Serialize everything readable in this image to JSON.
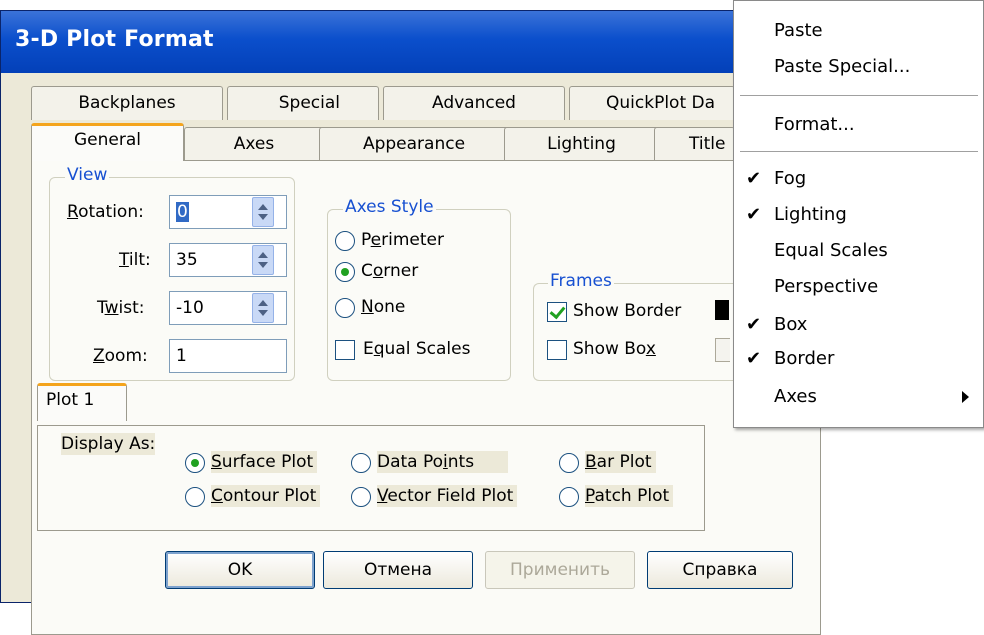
{
  "dialog": {
    "title": "3-D Plot Format",
    "tabs_row1": [
      "Backplanes",
      "Special",
      "Advanced",
      "QuickPlot Da"
    ],
    "tabs_row2": [
      "General",
      "Axes",
      "Appearance",
      "Lighting",
      "Title"
    ],
    "active_tab": "General",
    "view": {
      "group_label": "View",
      "rotation_label": "Rotation:",
      "rotation_value": "0",
      "tilt_label": "Tilt:",
      "tilt_value": "35",
      "twist_label": "Twist:",
      "twist_value": "-10",
      "zoom_label": "Zoom:",
      "zoom_value": "1"
    },
    "axes_style": {
      "group_label": "Axes Style",
      "options": [
        "Perimeter",
        "Corner",
        "None"
      ],
      "selected": "Corner",
      "equal_scales_label": "Equal Scales",
      "equal_scales_checked": false
    },
    "frames": {
      "group_label": "Frames",
      "show_border_label": "Show Border",
      "show_border_checked": true,
      "show_box_label": "Show Box",
      "show_box_checked": false
    },
    "plot_tab": {
      "label": "Plot 1",
      "display_as_label": "Display As:",
      "options": [
        "Surface Plot",
        "Data Points",
        "Bar Plot",
        "Contour Plot",
        "Vector Field Plot",
        "Patch Plot"
      ],
      "selected": "Surface Plot"
    },
    "buttons": {
      "ok": "OK",
      "cancel": "Отмена",
      "apply": "Применить",
      "help": "Справка"
    }
  },
  "context_menu": {
    "items": [
      {
        "label": "Paste",
        "checked": false
      },
      {
        "label": "Paste Special...",
        "checked": false
      },
      {
        "label": "Format...",
        "checked": false
      },
      {
        "label": "Fog",
        "checked": true
      },
      {
        "label": "Lighting",
        "checked": true
      },
      {
        "label": "Equal Scales",
        "checked": false
      },
      {
        "label": "Perspective",
        "checked": false
      },
      {
        "label": "Box",
        "checked": true
      },
      {
        "label": "Border",
        "checked": true
      },
      {
        "label": "Axes",
        "checked": false,
        "submenu": true
      }
    ],
    "check_glyph": "✔"
  },
  "colors": {
    "titlebar": "#0b4fcc",
    "group_label": "#1750d1",
    "active_tab_accent": "#f4a41c",
    "radio_dot": "#21a121"
  }
}
